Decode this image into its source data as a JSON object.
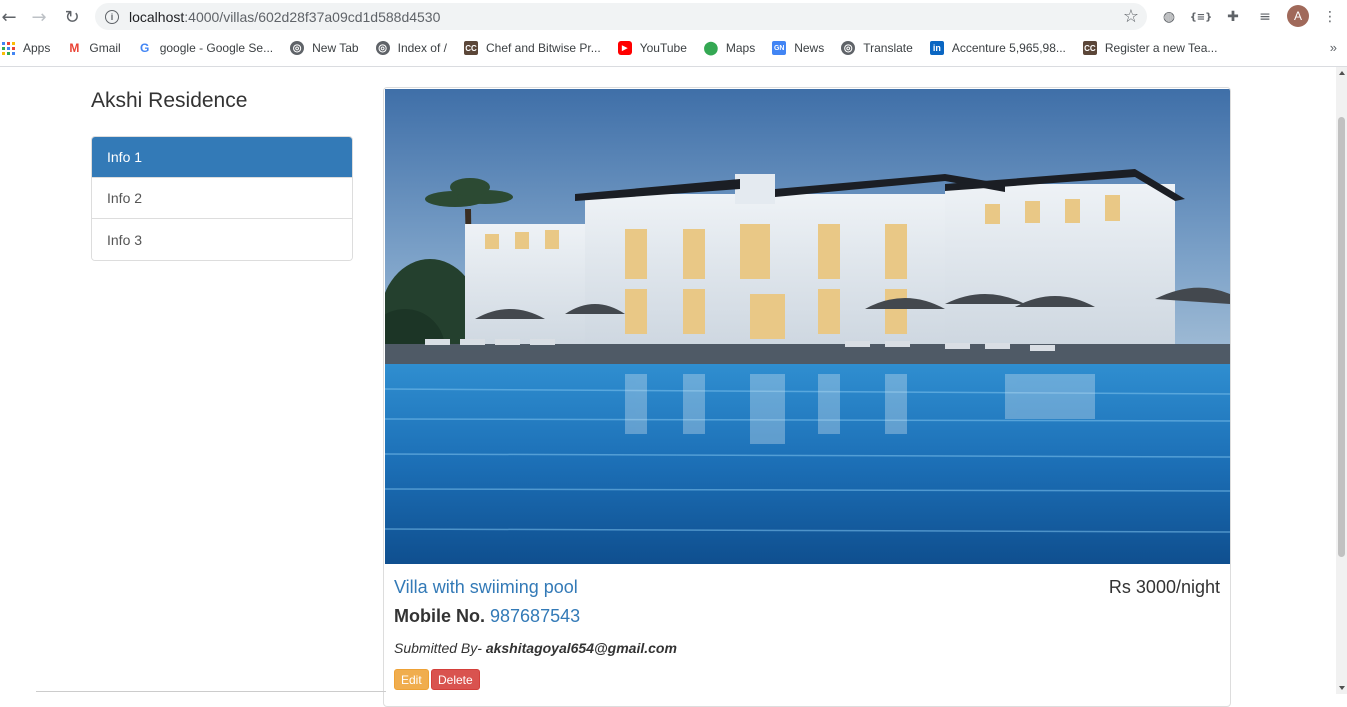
{
  "browser": {
    "url_host": "localhost",
    "url_path": ":4000/villas/602d28f37a09cd1d588d4530",
    "avatar_letter": "A",
    "bookmarks": [
      {
        "label": "Apps",
        "icon": "apps-grid-icon"
      },
      {
        "label": "Gmail",
        "icon": "gmail-icon"
      },
      {
        "label": "google - Google Se...",
        "icon": "google-icon"
      },
      {
        "label": "New Tab",
        "icon": "globe-icon"
      },
      {
        "label": "Index of /",
        "icon": "globe-icon"
      },
      {
        "label": "Chef and Bitwise Pr...",
        "icon": "codechef-icon"
      },
      {
        "label": "YouTube",
        "icon": "youtube-icon"
      },
      {
        "label": "Maps",
        "icon": "maps-pin-icon"
      },
      {
        "label": "News",
        "icon": "news-icon"
      },
      {
        "label": "Translate",
        "icon": "globe-icon"
      },
      {
        "label": "Accenture 5,965,98...",
        "icon": "linkedin-icon"
      },
      {
        "label": "Register a new Tea...",
        "icon": "codechef-icon"
      }
    ],
    "more_label": "»"
  },
  "sidebar": {
    "title": "Akshi Residence",
    "items": [
      {
        "label": "Info 1",
        "active": true
      },
      {
        "label": "Info 2",
        "active": false
      },
      {
        "label": "Info 3",
        "active": false
      }
    ]
  },
  "villa": {
    "title": "Villa with swiiming pool",
    "price": "Rs 3000/night",
    "mobile_label": "Mobile No.",
    "mobile_number": "987687543",
    "submitted_prefix": "Submitted By-",
    "submitted_email": "akshitagoyal654@gmail.com",
    "edit_label": "Edit",
    "delete_label": "Delete"
  },
  "colors": {
    "primary": "#337ab7",
    "warning": "#f0ad4e",
    "danger": "#d9534f"
  }
}
